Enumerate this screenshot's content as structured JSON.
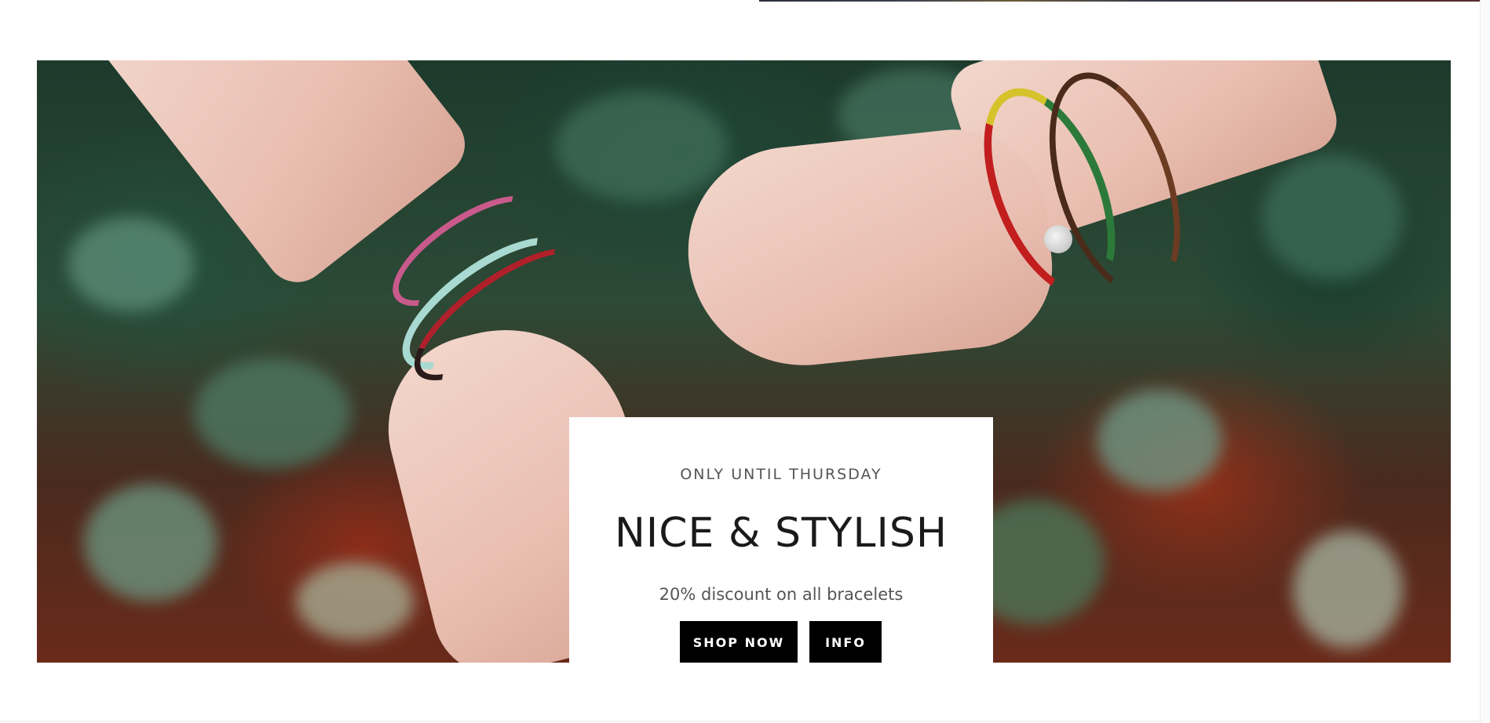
{
  "promo": {
    "eyebrow": "ONLY UNTIL THURSDAY",
    "title": "NICE & STYLISH",
    "subtitle": "20% discount on all bracelets",
    "primary_button": "SHOP NOW",
    "secondary_button": "INFO"
  },
  "colors": {
    "button_background": "#000000",
    "button_text": "#ffffff",
    "card_background": "#ffffff",
    "title_text": "#1a1a1a",
    "body_text": "#555555"
  }
}
